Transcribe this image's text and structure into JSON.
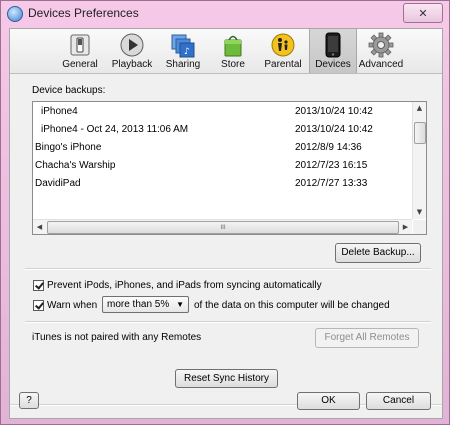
{
  "window": {
    "title": "Devices Preferences",
    "close_glyph": "✕"
  },
  "toolbar": {
    "items": [
      {
        "label": "General",
        "icon": "switch-icon"
      },
      {
        "label": "Playback",
        "icon": "play-icon"
      },
      {
        "label": "Sharing",
        "icon": "sharing-icon"
      },
      {
        "label": "Store",
        "icon": "shopping-bag-icon"
      },
      {
        "label": "Parental",
        "icon": "parental-icon"
      },
      {
        "label": "Devices",
        "icon": "phone-icon",
        "selected": true
      },
      {
        "label": "Advanced",
        "icon": "gear-icon"
      }
    ]
  },
  "backups": {
    "label": "Device backups:",
    "rows": [
      {
        "name": "iPhone4",
        "date": "2013/10/24 10:42"
      },
      {
        "name": "iPhone4 - Oct 24, 2013 11:06 AM",
        "date": "2013/10/24 10:42"
      },
      {
        "name": "Bingo's iPhone",
        "date": "2012/8/9 14:36"
      },
      {
        "name": "Chacha's Warship",
        "date": "2012/7/23 16:15"
      },
      {
        "name": "DavidiPad",
        "date": "2012/7/27 13:33"
      }
    ],
    "hscroll_grip": "III",
    "delete_label": "Delete Backup..."
  },
  "options": {
    "prevent_label": "Prevent iPods, iPhones, and iPads from syncing automatically",
    "prevent_checked": true,
    "warn_label": "Warn when",
    "warn_checked": true,
    "warn_select": "more than 5%",
    "warn_suffix": "of the data on this computer will be changed"
  },
  "remotes": {
    "status": "iTunes is not paired with any Remotes",
    "forget_label": "Forget All Remotes"
  },
  "reset_label": "Reset Sync History",
  "footer": {
    "help_label": "?",
    "ok_label": "OK",
    "cancel_label": "Cancel"
  },
  "colors": {
    "title_bar": "#f0c3e3",
    "selected_tab": "#cfcfcf"
  }
}
